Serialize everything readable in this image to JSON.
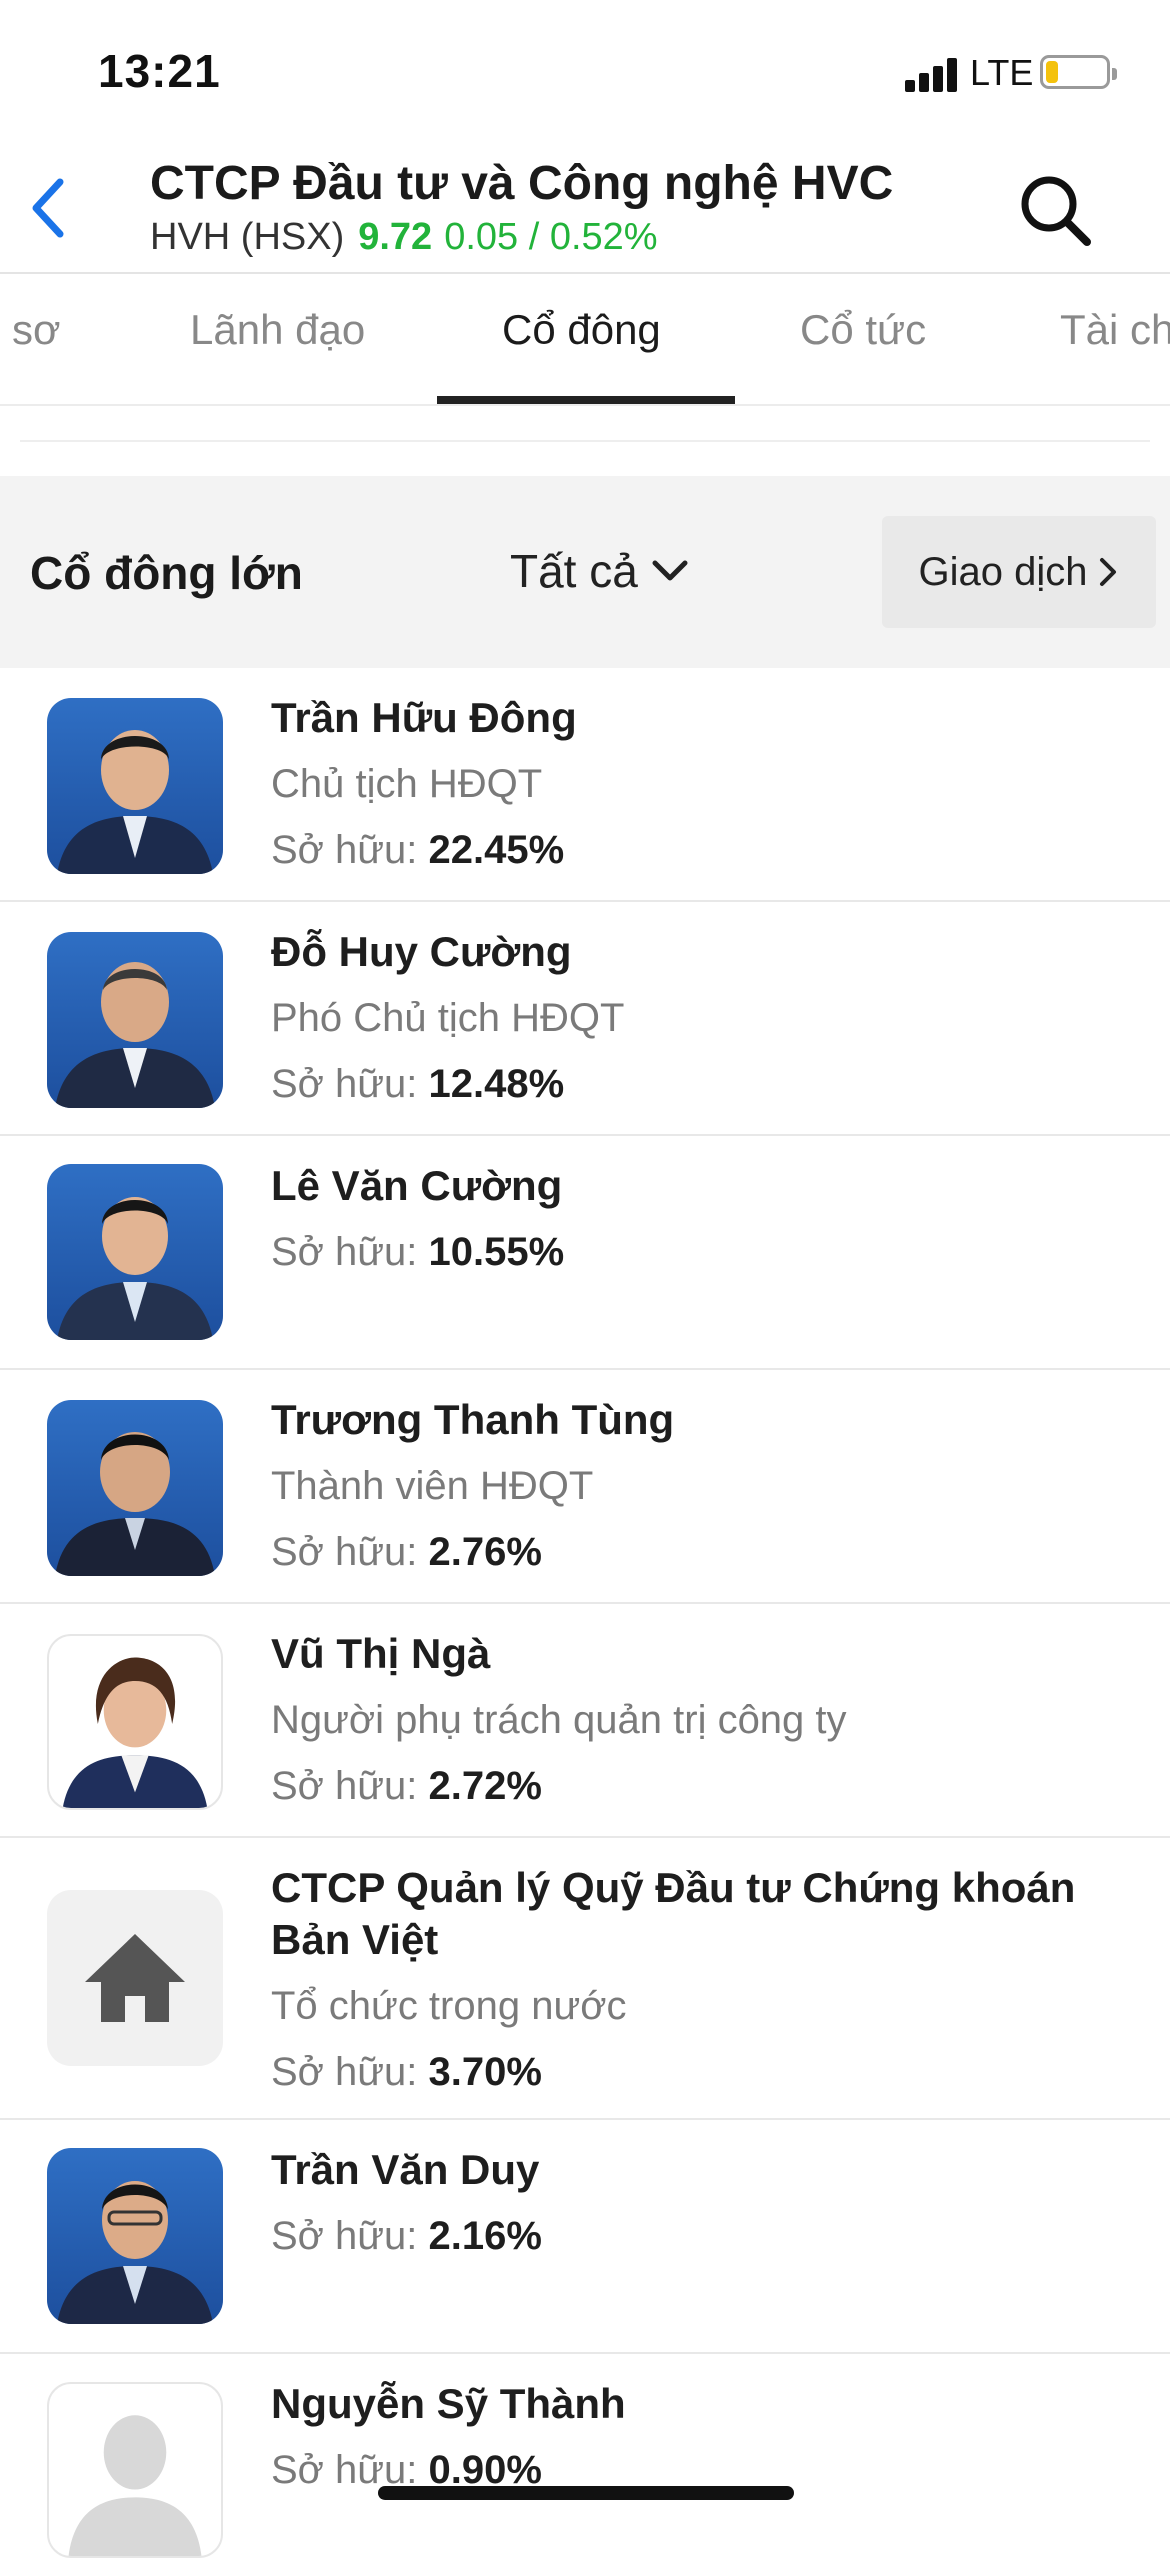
{
  "status_bar": {
    "time": "13:21",
    "network": "LTE"
  },
  "header": {
    "title": "CTCP Đầu tư và Công nghệ HVC",
    "ticker": "HVH (HSX)",
    "price": "9.72",
    "change": "0.05 / 0.52%",
    "accent_color": "#22b33a"
  },
  "tabs": [
    {
      "label": "sơ"
    },
    {
      "label": "Lãnh đạo"
    },
    {
      "label": "Cổ đông",
      "active": true
    },
    {
      "label": "Cổ tức"
    },
    {
      "label": "Tài ch"
    }
  ],
  "section": {
    "title": "Cổ đông lớn",
    "filter": "Tất cả",
    "trade_button": "Giao dịch"
  },
  "own_label": "Sở hữu:",
  "shareholders": [
    {
      "name": "Trần Hữu Đông",
      "role": "Chủ tịch HĐQT",
      "ownership": "22.45%",
      "avatar": "person-photo"
    },
    {
      "name": "Đỗ Huy Cường",
      "role": "Phó Chủ tịch HĐQT",
      "ownership": "12.48%",
      "avatar": "person-photo"
    },
    {
      "name": "Lê Văn Cường",
      "role": "",
      "ownership": "10.55%",
      "avatar": "person-photo"
    },
    {
      "name": "Trương Thanh Tùng",
      "role": "Thành viên HĐQT",
      "ownership": "2.76%",
      "avatar": "person-photo"
    },
    {
      "name": "Vũ Thị Ngà",
      "role": "Người phụ trách quản trị công ty",
      "ownership": "2.72%",
      "avatar": "person-photo"
    },
    {
      "name": "CTCP Quản lý Quỹ Đầu tư Chứng khoán Bản Việt",
      "role": "Tổ chức trong nước",
      "ownership": "3.70%",
      "avatar": "home-icon"
    },
    {
      "name": "Trần Văn Duy",
      "role": "",
      "ownership": "2.16%",
      "avatar": "person-photo"
    },
    {
      "name": "Nguyễn Sỹ Thành",
      "role": "",
      "ownership": "0.90%",
      "avatar": "default-user-icon"
    }
  ]
}
